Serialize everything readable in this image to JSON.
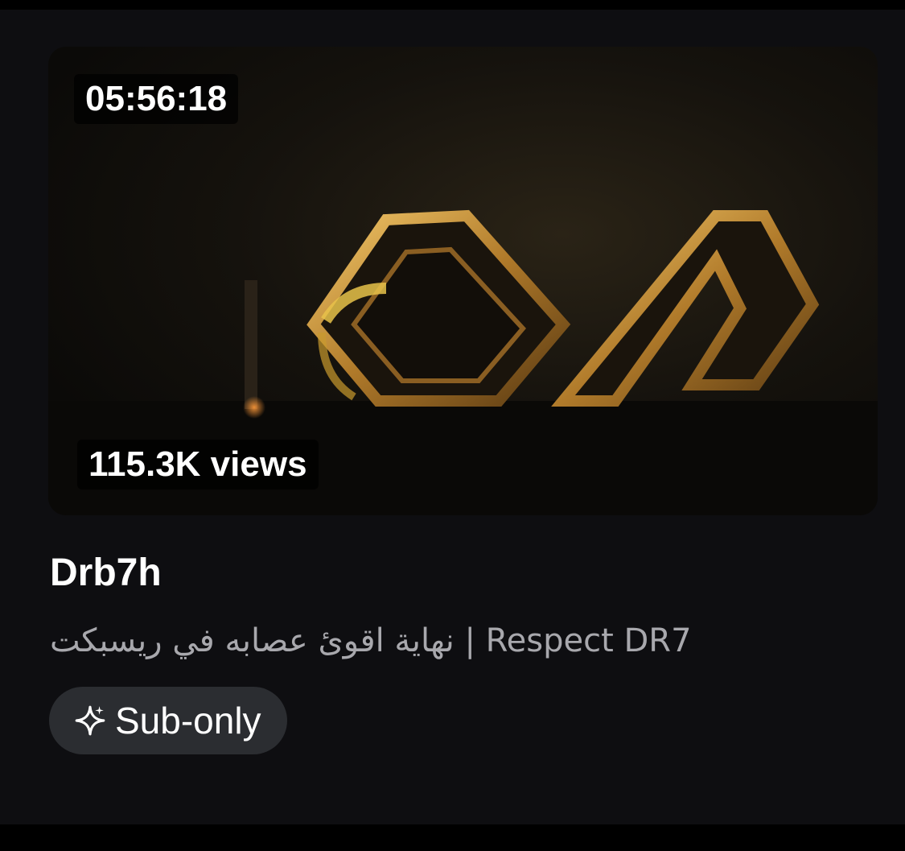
{
  "video": {
    "duration": "05:56:18",
    "views": "115.3K views",
    "title": "Drb7h",
    "subtitle": "نهاية اقوئ عصابه في ريسبكت | Respect DR7",
    "badge": {
      "label": "Sub-only",
      "icon": "sparkle-icon"
    }
  },
  "colors": {
    "background": "#0e0e11",
    "accent_gold": "#d4a24a",
    "badge_bg": "#2b2d31",
    "subtitle_text": "#a8a8ad"
  }
}
